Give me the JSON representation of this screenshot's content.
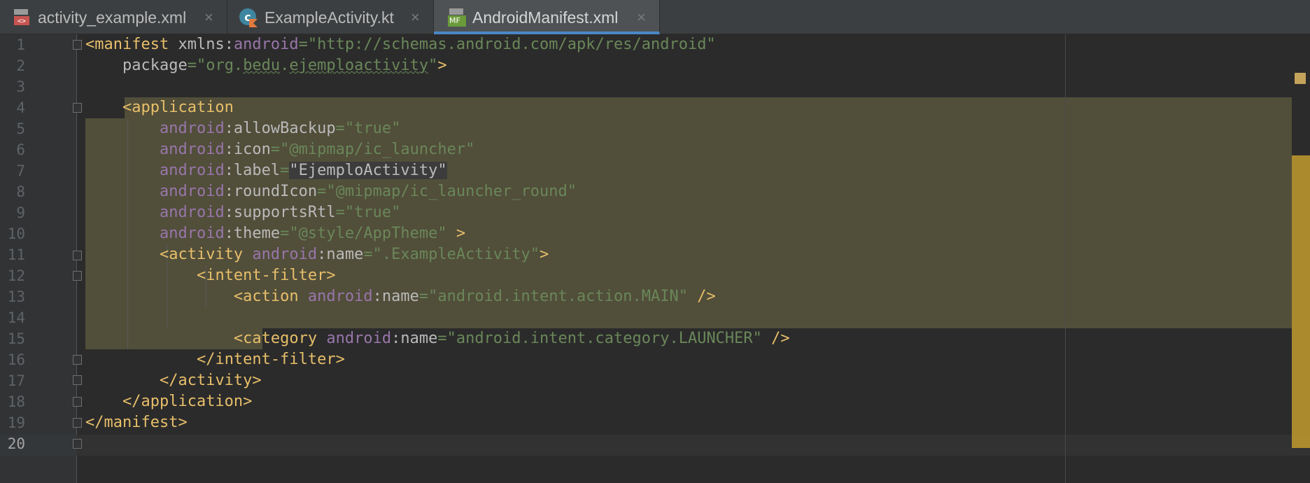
{
  "tabs": [
    {
      "label": "activity_example.xml",
      "icon": "xml-layout-icon",
      "active": false
    },
    {
      "label": "ExampleActivity.kt",
      "icon": "kotlin-class-icon",
      "active": false
    },
    {
      "label": "AndroidManifest.xml",
      "icon": "manifest-icon",
      "active": true
    }
  ],
  "tab_close_glyph": "×",
  "manifest_icon_text": "MF",
  "editor": {
    "current_line": "20",
    "lines": [
      {
        "num": "1"
      },
      {
        "num": "2"
      },
      {
        "num": "3"
      },
      {
        "num": "4"
      },
      {
        "num": "5"
      },
      {
        "num": "6"
      },
      {
        "num": "7"
      },
      {
        "num": "8"
      },
      {
        "num": "9"
      },
      {
        "num": "10"
      },
      {
        "num": "11"
      },
      {
        "num": "12"
      },
      {
        "num": "13"
      },
      {
        "num": "14"
      },
      {
        "num": "15"
      },
      {
        "num": "16"
      },
      {
        "num": "17"
      },
      {
        "num": "18"
      },
      {
        "num": "19"
      },
      {
        "num": "20"
      }
    ],
    "code": {
      "l1": [
        "<manifest",
        " xmlns:",
        "android",
        "=",
        "\"http://schemas.android.com/apk/res/android\""
      ],
      "l2": [
        "    package",
        "=",
        "\"org.",
        "bedu",
        ".",
        "ejemploactivity",
        "\"",
        ">"
      ],
      "l4": [
        "    ",
        "<application"
      ],
      "l5": [
        "        ",
        "android",
        ":allowBackup",
        "=",
        "\"true\""
      ],
      "l6": [
        "        ",
        "android",
        ":icon",
        "=",
        "\"@mipmap/ic_launcher\""
      ],
      "l7": [
        "        ",
        "android",
        ":label",
        "=",
        "\"EjemploActivity\""
      ],
      "l8": [
        "        ",
        "android",
        ":roundIcon",
        "=",
        "\"@mipmap/ic_launcher_round\""
      ],
      "l9": [
        "        ",
        "android",
        ":supportsRtl",
        "=",
        "\"true\""
      ],
      "l10": [
        "        ",
        "android",
        ":theme",
        "=",
        "\"@style/AppTheme\"",
        " >"
      ],
      "l11": [
        "        ",
        "<activity ",
        "android",
        ":name",
        "=",
        "\".ExampleActivity\"",
        ">"
      ],
      "l12": [
        "            ",
        "<intent-filter>"
      ],
      "l13": [
        "                ",
        "<action ",
        "android",
        ":name",
        "=",
        "\"android.intent.action.MAIN\"",
        " />"
      ],
      "l15": [
        "                ",
        "<category ",
        "android",
        ":name",
        "=",
        "\"android.intent.category.LAUNCHER\"",
        " />"
      ],
      "l16": [
        "            ",
        "</intent-filter>"
      ],
      "l17": [
        "        ",
        "</activity>"
      ],
      "l18": [
        "    ",
        "</application>"
      ],
      "l19": [
        "</manifest>"
      ]
    }
  },
  "colors": {
    "background": "#2b2b2b",
    "gutter": "#313335",
    "selection": "#514e3a",
    "tag": "#e8bf6a",
    "namespace": "#9876aa",
    "attribute": "#bababa",
    "value": "#6a8759",
    "active_tab_underline": "#4a88c7",
    "scroll_marker": "#b9952e"
  }
}
